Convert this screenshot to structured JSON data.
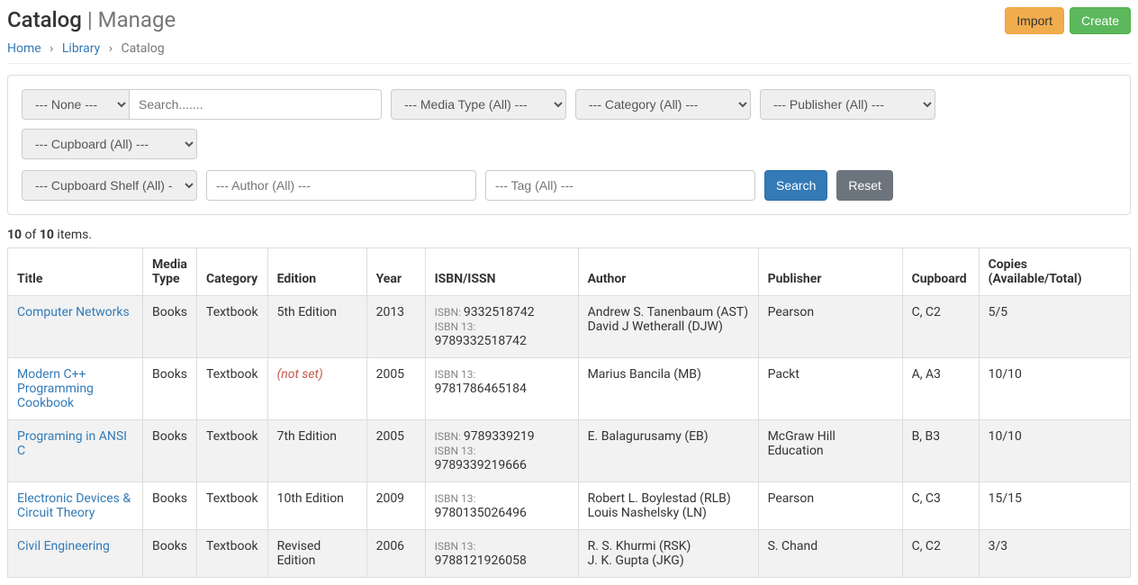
{
  "header": {
    "title_main": "Catalog",
    "title_sub": "Manage",
    "btn_import": "Import",
    "btn_create": "Create"
  },
  "breadcrumb": {
    "home": "Home",
    "library": "Library",
    "current": "Catalog"
  },
  "filters": {
    "none_option": "--- None ---",
    "search_placeholder": "Search.......",
    "media_type_option": "--- Media Type (All) ---",
    "category_option": "--- Category (All) ---",
    "publisher_option": "--- Publisher (All) ---",
    "cupboard_option": "--- Cupboard (All) ---",
    "cupboard_shelf_option": "--- Cupboard Shelf (All) ---",
    "author_placeholder": "--- Author (All) ---",
    "tag_placeholder": "--- Tag (All) ---",
    "btn_search": "Search",
    "btn_reset": "Reset"
  },
  "summary": {
    "count": "10",
    "total": "10",
    "of": " of ",
    "items": " items."
  },
  "table": {
    "headers": {
      "title": "Title",
      "media_type": "Media Type",
      "category": "Category",
      "edition": "Edition",
      "year": "Year",
      "isbn": "ISBN/ISSN",
      "author": "Author",
      "publisher": "Publisher",
      "cupboard": "Cupboard",
      "copies": "Copies (Available/Total)"
    },
    "isbn_label": "ISBN:",
    "isbn13_label": "ISBN 13:",
    "not_set": "(not set)",
    "rows": [
      {
        "title": "Computer Networks",
        "media_type": "Books",
        "category": "Textbook",
        "edition": "5th Edition",
        "year": "2013",
        "isbn": "9332518742",
        "isbn13": "9789332518742",
        "authors": [
          "Andrew S. Tanenbaum (AST)",
          "David J Wetherall (DJW)"
        ],
        "publisher": "Pearson",
        "cupboard": "C, C2",
        "copies": "5/5"
      },
      {
        "title": "Modern C++ Programming Cookbook",
        "media_type": "Books",
        "category": "Textbook",
        "edition": "",
        "year": "2005",
        "isbn": "",
        "isbn13": "9781786465184",
        "authors": [
          "Marius Bancila (MB)"
        ],
        "publisher": "Packt",
        "cupboard": "A, A3",
        "copies": "10/10"
      },
      {
        "title": "Programing in ANSI C",
        "media_type": "Books",
        "category": "Textbook",
        "edition": "7th Edition",
        "year": "2005",
        "isbn": "9789339219",
        "isbn13": "9789339219666",
        "authors": [
          "E. Balagurusamy (EB)"
        ],
        "publisher": "McGraw Hill Education",
        "cupboard": "B, B3",
        "copies": "10/10"
      },
      {
        "title": "Electronic Devices & Circuit Theory",
        "media_type": "Books",
        "category": "Textbook",
        "edition": "10th Edition",
        "year": "2009",
        "isbn": "",
        "isbn13": "9780135026496",
        "authors": [
          "Robert L. Boylestad (RLB)",
          "Louis Nashelsky (LN)"
        ],
        "publisher": "Pearson",
        "cupboard": "C, C3",
        "copies": "15/15"
      },
      {
        "title": "Civil Engineering",
        "media_type": "Books",
        "category": "Textbook",
        "edition": "Revised Edition",
        "year": "2006",
        "isbn": "",
        "isbn13": "9788121926058",
        "authors": [
          "R. S. Khurmi (RSK)",
          "J. K. Gupta (JKG)"
        ],
        "publisher": "S. Chand",
        "cupboard": "C, C2",
        "copies": "3/3"
      }
    ]
  }
}
